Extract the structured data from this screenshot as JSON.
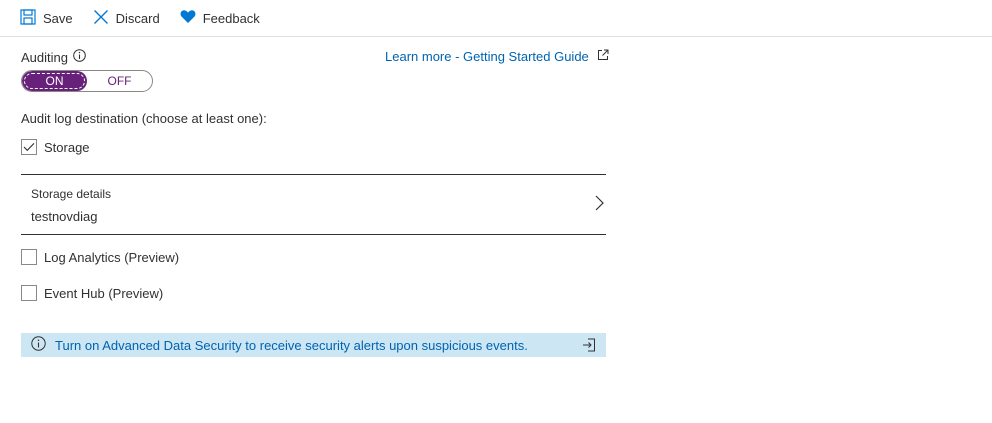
{
  "toolbar": {
    "save_label": "Save",
    "discard_label": "Discard",
    "feedback_label": "Feedback"
  },
  "auditing": {
    "label": "Auditing",
    "toggle_on": "ON",
    "toggle_off": "OFF",
    "state": "ON"
  },
  "learn_more": {
    "label": "Learn more - Getting Started Guide"
  },
  "destination": {
    "label": "Audit log destination (choose at least one):",
    "storage": {
      "label": "Storage",
      "checked": true
    },
    "log_analytics": {
      "label": "Log Analytics (Preview)",
      "checked": false
    },
    "event_hub": {
      "label": "Event Hub (Preview)",
      "checked": false
    }
  },
  "storage_details": {
    "title": "Storage details",
    "value": "testnovdiag"
  },
  "banner": {
    "message": "Turn on Advanced Data Security to receive security alerts upon suspicious events."
  },
  "colors": {
    "accent_purple": "#68217a",
    "link_blue": "#0063b1",
    "banner_bg": "#cce6f4",
    "icon_blue": "#0078d4"
  },
  "icons": {
    "save": "save-icon",
    "discard": "close-icon",
    "feedback": "heart-icon",
    "info": "info-icon",
    "external": "external-link-icon",
    "chevron": "chevron-right-icon",
    "navigate": "navigate-icon"
  }
}
